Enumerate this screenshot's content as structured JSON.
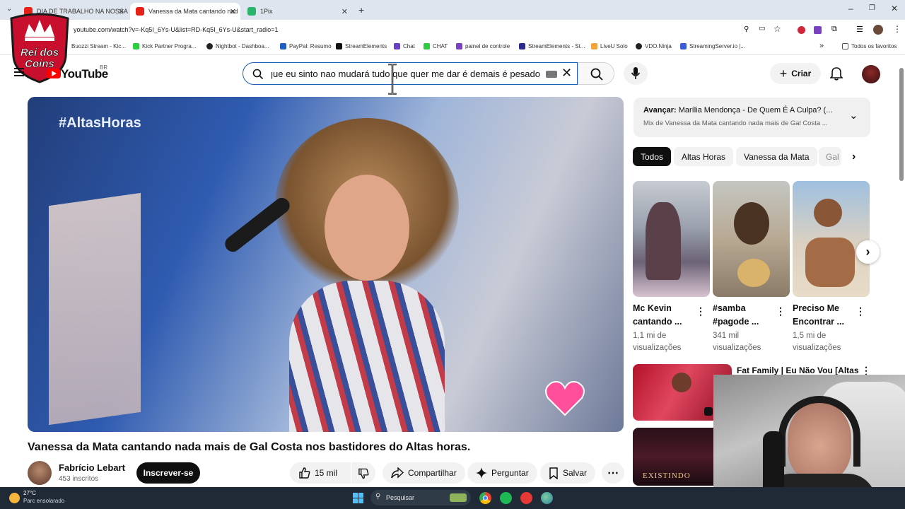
{
  "browser": {
    "tabs": [
      {
        "label": "DIA DE TRABALHO NA NOSSA",
        "color": "#e62117"
      },
      {
        "label": "Vanessa da Mata cantando nad",
        "color": "#e62117"
      },
      {
        "label": "1Pix",
        "color": "#29b36b"
      }
    ],
    "new_tab": "+",
    "url": "youtube.com/watch?v=-Kq5I_6Ys-U&list=RD-Kq5I_6Ys-U&start_radio=1",
    "bookmarks": [
      "Buozzi Stream - Kic...",
      "Kick Partner Progra...",
      "Nightbot - Dashboa...",
      "PayPal: Resumo",
      "StreamElements",
      "Chat",
      "CHAT",
      "painel de controle",
      "StreamElements - St...",
      "LiveU Solo",
      "VDO.Ninja",
      "StreamingServer.io |..."
    ],
    "bookmarks_more": "»",
    "all_bookmarks": "Todos os favoritos"
  },
  "overlay_logo": {
    "line1": "Rei dos",
    "line2": "Coins"
  },
  "youtube": {
    "logo": "YouTube",
    "country": "BR",
    "search_value": "que eu sinto nao mudará tudo que quer me dar é demais é pesado",
    "create_label": "Criar"
  },
  "video": {
    "watermark": "#AltasHoras",
    "title": "Vanessa da Mata cantando nada mais de Gal Costa nos bastidores do Altas horas."
  },
  "channel": {
    "name": "Fabrício Lebart",
    "subs": "453 inscritos",
    "subscribe_label": "Inscrever-se"
  },
  "actions": {
    "likes": "15 mil",
    "share": "Compartilhar",
    "ask": "Perguntar",
    "save": "Salvar"
  },
  "next_up": {
    "label": "Avançar:",
    "title": "Marília Mendonça - De Quem É A Culpa? (...",
    "subtitle": "Mix de Vanessa da Mata cantando nada mais de Gal Costa ..."
  },
  "chips": [
    "Todos",
    "Altas Horas",
    "Vanessa da Mata",
    "Gal"
  ],
  "shorts": [
    {
      "title_line1": "Mc Kevin",
      "title_line2": "cantando ...",
      "views_line1": "1,1 mi de",
      "views_line2": "visualizações"
    },
    {
      "title_line1": "#samba",
      "title_line2": "#pagode ...",
      "views_line1": "341 mil",
      "views_line2": "visualizações"
    },
    {
      "title_line1": "Preciso Me",
      "title_line2": "Encontrar ...",
      "views_line1": "1,5 mi de",
      "views_line2": "visualizações"
    }
  ],
  "rec": [
    {
      "title": "Fat Family | Eu Não Vou [Altas"
    },
    {
      "thumb_text": "EXISTINDO"
    }
  ],
  "taskbar": {
    "temp": "27°C",
    "weather": "Parc ensolarado",
    "search": "Pesquisar"
  }
}
